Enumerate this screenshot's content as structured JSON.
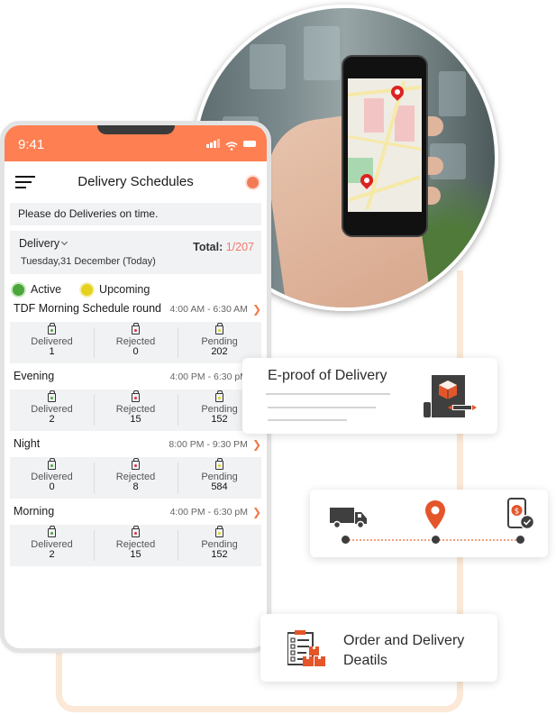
{
  "phone": {
    "status_bar": {
      "time": "9:41",
      "icons": [
        "signal-icon",
        "wifi-icon",
        "battery-icon"
      ]
    },
    "header": {
      "menu_icon": "hamburger-menu-icon",
      "title": "Delivery Schedules",
      "status_icon": "record-dot-icon"
    },
    "notice": "Please do Deliveries on time.",
    "delivery_filter": {
      "label": "Delivery",
      "date": "Tuesday,31 December (Today)",
      "total_label": "Total:",
      "total_value": "1/207"
    },
    "legend": [
      {
        "label": "Active",
        "color": "#4aa63a"
      },
      {
        "label": "Upcoming",
        "color": "#e6d21d"
      }
    ],
    "schedules": [
      {
        "name": "TDF Morning Schedule round",
        "time": "4:00 AM - 6:30 AM",
        "stats": [
          {
            "label": "Delivered",
            "value": "1"
          },
          {
            "label": "Rejected",
            "value": "0"
          },
          {
            "label": "Pending",
            "value": "202"
          }
        ]
      },
      {
        "name": "Evening",
        "time": "4:00 PM - 6:30 pM",
        "stats": [
          {
            "label": "Delivered",
            "value": "2"
          },
          {
            "label": "Rejected",
            "value": "15"
          },
          {
            "label": "Pending",
            "value": "152"
          }
        ]
      },
      {
        "name": "Night",
        "time": "8:00 PM - 9:30 PM",
        "stats": [
          {
            "label": "Delivered",
            "value": "0"
          },
          {
            "label": "Rejected",
            "value": "8"
          },
          {
            "label": "Pending",
            "value": "584"
          }
        ]
      },
      {
        "name": "Morning",
        "time": "4:00 PM - 6:30 pM",
        "stats": [
          {
            "label": "Delivered",
            "value": "2"
          },
          {
            "label": "Rejected",
            "value": "15"
          },
          {
            "label": "Pending",
            "value": "152"
          }
        ]
      }
    ]
  },
  "cards": {
    "eproof": {
      "title": "E-proof of Delivery",
      "icon": "document-box-pen-icon"
    },
    "timeline": {
      "icons": [
        "truck-icon",
        "location-pin-icon",
        "mobile-payment-check-icon"
      ]
    },
    "order": {
      "title": "Order and Delivery Deatils",
      "icon": "clipboard-boxes-icon"
    }
  },
  "photo": {
    "description": "hand-holding-phone-with-map"
  },
  "colors": {
    "accent": "#fd7f52",
    "brand_orange": "#e4552a",
    "delivered": "#4aa63a",
    "rejected": "#e0323c",
    "pending": "#e6d21d",
    "peach_frame": "#fbe8d6"
  }
}
